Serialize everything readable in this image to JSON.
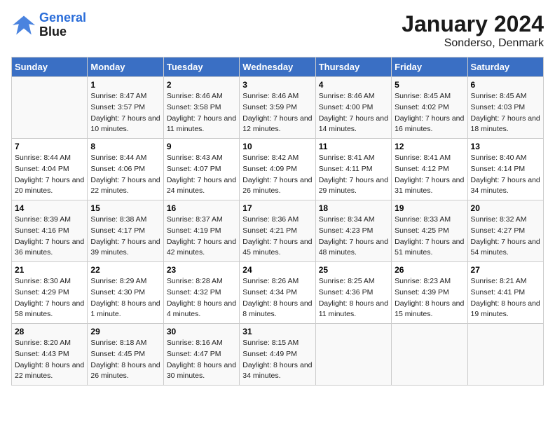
{
  "logo": {
    "line1": "General",
    "line2": "Blue"
  },
  "title": "January 2024",
  "subtitle": "Sonderso, Denmark",
  "days_of_week": [
    "Sunday",
    "Monday",
    "Tuesday",
    "Wednesday",
    "Thursday",
    "Friday",
    "Saturday"
  ],
  "weeks": [
    [
      {
        "day": "",
        "sunrise": "",
        "sunset": "",
        "daylight": ""
      },
      {
        "day": "1",
        "sunrise": "Sunrise: 8:47 AM",
        "sunset": "Sunset: 3:57 PM",
        "daylight": "Daylight: 7 hours and 10 minutes."
      },
      {
        "day": "2",
        "sunrise": "Sunrise: 8:46 AM",
        "sunset": "Sunset: 3:58 PM",
        "daylight": "Daylight: 7 hours and 11 minutes."
      },
      {
        "day": "3",
        "sunrise": "Sunrise: 8:46 AM",
        "sunset": "Sunset: 3:59 PM",
        "daylight": "Daylight: 7 hours and 12 minutes."
      },
      {
        "day": "4",
        "sunrise": "Sunrise: 8:46 AM",
        "sunset": "Sunset: 4:00 PM",
        "daylight": "Daylight: 7 hours and 14 minutes."
      },
      {
        "day": "5",
        "sunrise": "Sunrise: 8:45 AM",
        "sunset": "Sunset: 4:02 PM",
        "daylight": "Daylight: 7 hours and 16 minutes."
      },
      {
        "day": "6",
        "sunrise": "Sunrise: 8:45 AM",
        "sunset": "Sunset: 4:03 PM",
        "daylight": "Daylight: 7 hours and 18 minutes."
      }
    ],
    [
      {
        "day": "7",
        "sunrise": "Sunrise: 8:44 AM",
        "sunset": "Sunset: 4:04 PM",
        "daylight": "Daylight: 7 hours and 20 minutes."
      },
      {
        "day": "8",
        "sunrise": "Sunrise: 8:44 AM",
        "sunset": "Sunset: 4:06 PM",
        "daylight": "Daylight: 7 hours and 22 minutes."
      },
      {
        "day": "9",
        "sunrise": "Sunrise: 8:43 AM",
        "sunset": "Sunset: 4:07 PM",
        "daylight": "Daylight: 7 hours and 24 minutes."
      },
      {
        "day": "10",
        "sunrise": "Sunrise: 8:42 AM",
        "sunset": "Sunset: 4:09 PM",
        "daylight": "Daylight: 7 hours and 26 minutes."
      },
      {
        "day": "11",
        "sunrise": "Sunrise: 8:41 AM",
        "sunset": "Sunset: 4:11 PM",
        "daylight": "Daylight: 7 hours and 29 minutes."
      },
      {
        "day": "12",
        "sunrise": "Sunrise: 8:41 AM",
        "sunset": "Sunset: 4:12 PM",
        "daylight": "Daylight: 7 hours and 31 minutes."
      },
      {
        "day": "13",
        "sunrise": "Sunrise: 8:40 AM",
        "sunset": "Sunset: 4:14 PM",
        "daylight": "Daylight: 7 hours and 34 minutes."
      }
    ],
    [
      {
        "day": "14",
        "sunrise": "Sunrise: 8:39 AM",
        "sunset": "Sunset: 4:16 PM",
        "daylight": "Daylight: 7 hours and 36 minutes."
      },
      {
        "day": "15",
        "sunrise": "Sunrise: 8:38 AM",
        "sunset": "Sunset: 4:17 PM",
        "daylight": "Daylight: 7 hours and 39 minutes."
      },
      {
        "day": "16",
        "sunrise": "Sunrise: 8:37 AM",
        "sunset": "Sunset: 4:19 PM",
        "daylight": "Daylight: 7 hours and 42 minutes."
      },
      {
        "day": "17",
        "sunrise": "Sunrise: 8:36 AM",
        "sunset": "Sunset: 4:21 PM",
        "daylight": "Daylight: 7 hours and 45 minutes."
      },
      {
        "day": "18",
        "sunrise": "Sunrise: 8:34 AM",
        "sunset": "Sunset: 4:23 PM",
        "daylight": "Daylight: 7 hours and 48 minutes."
      },
      {
        "day": "19",
        "sunrise": "Sunrise: 8:33 AM",
        "sunset": "Sunset: 4:25 PM",
        "daylight": "Daylight: 7 hours and 51 minutes."
      },
      {
        "day": "20",
        "sunrise": "Sunrise: 8:32 AM",
        "sunset": "Sunset: 4:27 PM",
        "daylight": "Daylight: 7 hours and 54 minutes."
      }
    ],
    [
      {
        "day": "21",
        "sunrise": "Sunrise: 8:30 AM",
        "sunset": "Sunset: 4:29 PM",
        "daylight": "Daylight: 7 hours and 58 minutes."
      },
      {
        "day": "22",
        "sunrise": "Sunrise: 8:29 AM",
        "sunset": "Sunset: 4:30 PM",
        "daylight": "Daylight: 8 hours and 1 minute."
      },
      {
        "day": "23",
        "sunrise": "Sunrise: 8:28 AM",
        "sunset": "Sunset: 4:32 PM",
        "daylight": "Daylight: 8 hours and 4 minutes."
      },
      {
        "day": "24",
        "sunrise": "Sunrise: 8:26 AM",
        "sunset": "Sunset: 4:34 PM",
        "daylight": "Daylight: 8 hours and 8 minutes."
      },
      {
        "day": "25",
        "sunrise": "Sunrise: 8:25 AM",
        "sunset": "Sunset: 4:36 PM",
        "daylight": "Daylight: 8 hours and 11 minutes."
      },
      {
        "day": "26",
        "sunrise": "Sunrise: 8:23 AM",
        "sunset": "Sunset: 4:39 PM",
        "daylight": "Daylight: 8 hours and 15 minutes."
      },
      {
        "day": "27",
        "sunrise": "Sunrise: 8:21 AM",
        "sunset": "Sunset: 4:41 PM",
        "daylight": "Daylight: 8 hours and 19 minutes."
      }
    ],
    [
      {
        "day": "28",
        "sunrise": "Sunrise: 8:20 AM",
        "sunset": "Sunset: 4:43 PM",
        "daylight": "Daylight: 8 hours and 22 minutes."
      },
      {
        "day": "29",
        "sunrise": "Sunrise: 8:18 AM",
        "sunset": "Sunset: 4:45 PM",
        "daylight": "Daylight: 8 hours and 26 minutes."
      },
      {
        "day": "30",
        "sunrise": "Sunrise: 8:16 AM",
        "sunset": "Sunset: 4:47 PM",
        "daylight": "Daylight: 8 hours and 30 minutes."
      },
      {
        "day": "31",
        "sunrise": "Sunrise: 8:15 AM",
        "sunset": "Sunset: 4:49 PM",
        "daylight": "Daylight: 8 hours and 34 minutes."
      },
      {
        "day": "",
        "sunrise": "",
        "sunset": "",
        "daylight": ""
      },
      {
        "day": "",
        "sunrise": "",
        "sunset": "",
        "daylight": ""
      },
      {
        "day": "",
        "sunrise": "",
        "sunset": "",
        "daylight": ""
      }
    ]
  ]
}
